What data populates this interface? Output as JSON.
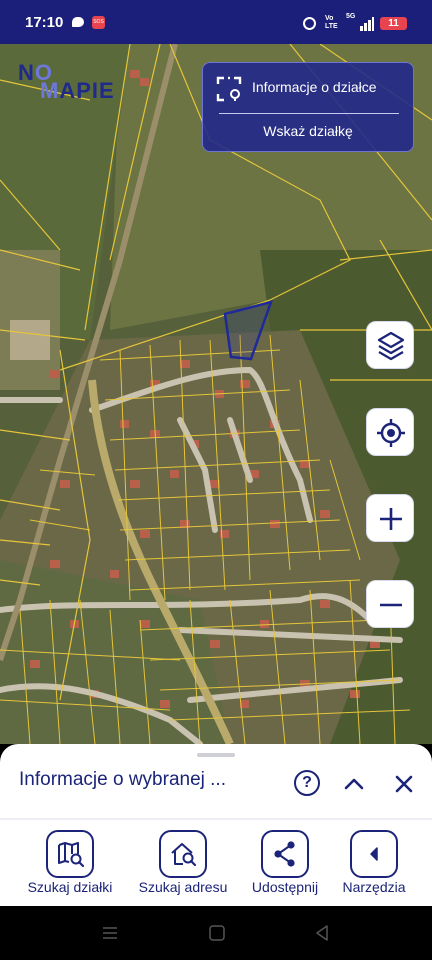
{
  "status_bar": {
    "time": "17:10",
    "battery": "11",
    "network": "5G",
    "volte": "Vo LTE"
  },
  "logo": {
    "line1": "NO",
    "line2": "MAPIE"
  },
  "info_panel": {
    "title": "Informacje o działce",
    "action": "Wskaż działkę"
  },
  "map_controls": [
    {
      "name": "layers",
      "icon": "layers-icon"
    },
    {
      "name": "locate",
      "icon": "locate-icon"
    },
    {
      "name": "zoom-in",
      "icon": "plus-icon"
    },
    {
      "name": "zoom-out",
      "icon": "minus-icon"
    }
  ],
  "bottom_sheet": {
    "title": "Informacje o wybranej ...",
    "help_label": "?"
  },
  "tools": [
    {
      "label": "Szukaj działki",
      "icon": "map-search-icon"
    },
    {
      "label": "Szukaj adresu",
      "icon": "home-search-icon"
    },
    {
      "label": "Udostępnij",
      "icon": "share-icon"
    },
    {
      "label": "Narzędzia",
      "icon": "chevron-left-icon"
    }
  ],
  "colors": {
    "primary": "#1b2478",
    "panel": "#20268c",
    "parcel_lines": "#e5c53a",
    "selected_parcel": "#1f2a9a",
    "status_bar": "#1b1f7a"
  }
}
